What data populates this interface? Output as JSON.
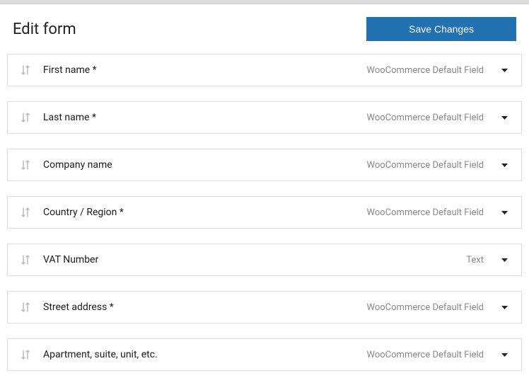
{
  "header": {
    "title": "Edit form",
    "save_button": "Save Changes"
  },
  "default_type_label": "WooCommerce Default Field",
  "fields": [
    {
      "label": "First name *",
      "type": "WooCommerce Default Field"
    },
    {
      "label": "Last name *",
      "type": "WooCommerce Default Field"
    },
    {
      "label": "Company name",
      "type": "WooCommerce Default Field"
    },
    {
      "label": "Country / Region *",
      "type": "WooCommerce Default Field"
    },
    {
      "label": "VAT Number",
      "type": "Text"
    },
    {
      "label": "Street address *",
      "type": "WooCommerce Default Field"
    },
    {
      "label": "Apartment, suite, unit, etc.",
      "type": "WooCommerce Default Field"
    }
  ]
}
